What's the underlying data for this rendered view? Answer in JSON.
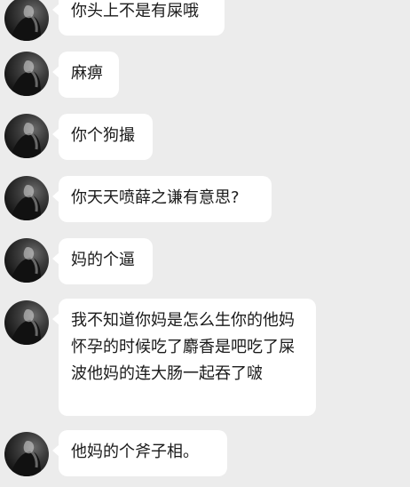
{
  "messages": [
    {
      "text": "你头上不是有屎哦"
    },
    {
      "text": "麻痹"
    },
    {
      "text": "你个狗撮"
    },
    {
      "text": "你天天喷薛之谦有意思?"
    },
    {
      "text": "妈的个逼"
    },
    {
      "text": "我不知道你妈是怎么生你的他妈怀孕的时候吃了麝香是吧吃了屎波他妈的连大肠一起吞了啵"
    },
    {
      "text": "他妈的个斧子相。"
    }
  ]
}
